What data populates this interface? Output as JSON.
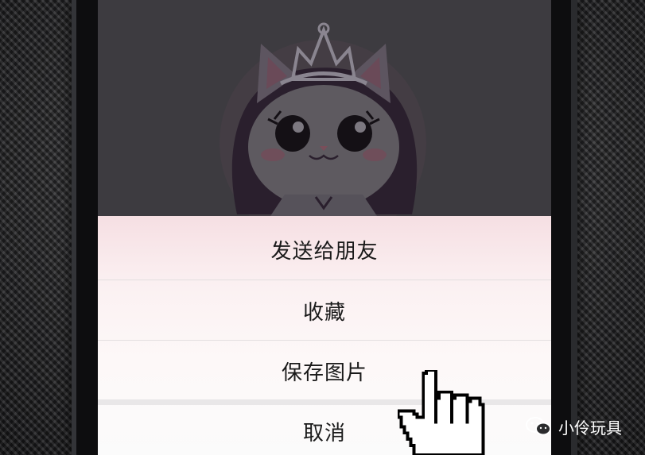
{
  "action_sheet": {
    "items": [
      {
        "label": "发送给朋友"
      },
      {
        "label": "收藏"
      },
      {
        "label": "保存图片"
      }
    ],
    "cancel_label": "取消"
  },
  "watermark": {
    "text": "小伶玩具",
    "icon": "wechat-logo-icon"
  },
  "background_image": {
    "icon": "princess-cat-illustration"
  },
  "cursor": {
    "icon": "pointing-hand-cursor-icon"
  },
  "colors": {
    "sheet_top": "#f6dfe3",
    "sheet_bottom": "#fbfbfb",
    "overlay": "#3d3b40",
    "text": "#1a1a1a"
  }
}
